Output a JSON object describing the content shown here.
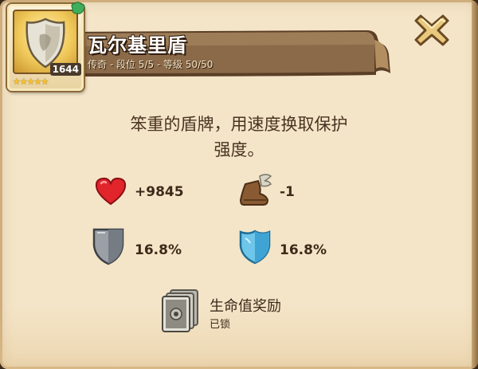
{
  "item": {
    "name": "瓦尔基里盾",
    "subtitle": "传奇 - 段位 5/5 - 等级 50/50",
    "power": "1644",
    "stars": 5,
    "icon": "shield-item-icon"
  },
  "description": {
    "line1": "笨重的盾牌，用速度换取保护",
    "line2": "强度。"
  },
  "stats": {
    "health": {
      "icon": "heart-icon",
      "value": "+9845"
    },
    "speed": {
      "icon": "winged-boot-icon",
      "value": "-1"
    },
    "physical_armor": {
      "icon": "gray-shield-icon",
      "value": "16.8%"
    },
    "magic_armor": {
      "icon": "blue-shield-icon",
      "value": "16.8%"
    }
  },
  "reward": {
    "icon": "locked-cards-icon",
    "title": "生命值奖励",
    "status": "已锁"
  },
  "close": {
    "icon": "close-x-icon"
  },
  "colors": {
    "panel": "#f4e5c8",
    "banner": "#7a5a3a",
    "text": "#3d2a1a",
    "close": "#d9b56a"
  }
}
